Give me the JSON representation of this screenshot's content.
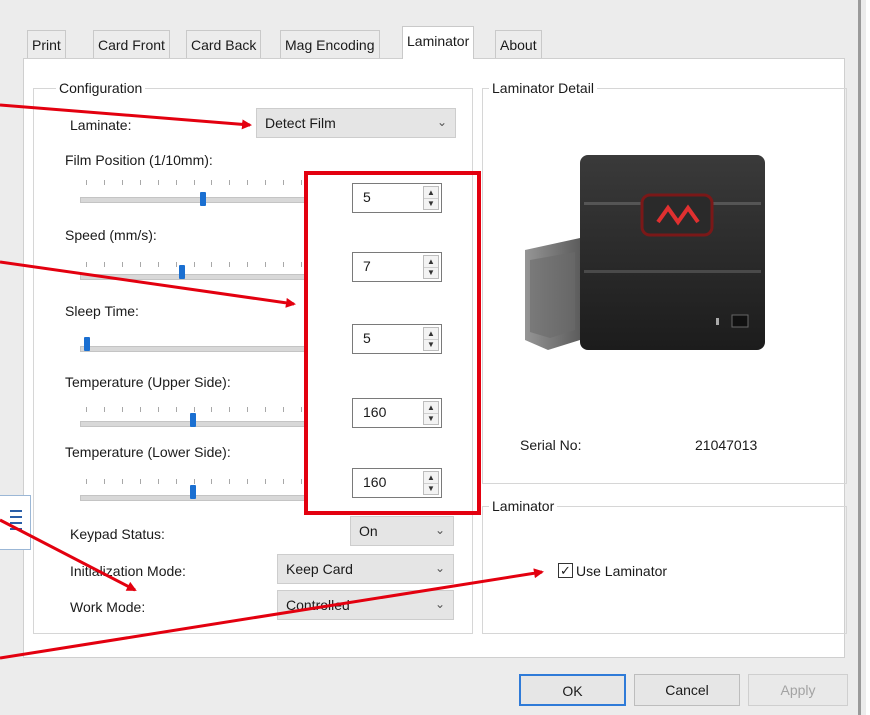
{
  "tabs": [
    {
      "label": "Print"
    },
    {
      "label": "Card Front"
    },
    {
      "label": "Card Back"
    },
    {
      "label": "Mag Encoding"
    },
    {
      "label": "Laminator",
      "active": true
    },
    {
      "label": "About"
    }
  ],
  "configuration": {
    "title": "Configuration",
    "laminate": {
      "label": "Laminate:",
      "value": "Detect Film"
    },
    "film_position": {
      "label": "Film Position (1/10mm):",
      "value": "5",
      "slider_level": 0.55
    },
    "speed": {
      "label": "Speed (mm/s):",
      "value": "7",
      "slider_level": 0.45
    },
    "sleep_time": {
      "label": "Sleep Time:",
      "value": "5",
      "slider_level": 0.02
    },
    "temp_upper": {
      "label": "Temperature (Upper Side):",
      "value": "160",
      "slider_level": 0.5
    },
    "temp_lower": {
      "label": "Temperature (Lower Side):",
      "value": "160",
      "slider_level": 0.5
    },
    "keypad_status": {
      "label": "Keypad Status:",
      "value": "On"
    },
    "initialization_mode": {
      "label": "Initialization Mode:",
      "value": "Keep Card"
    },
    "work_mode": {
      "label": "Work Mode:",
      "value": "Controlled"
    }
  },
  "laminator_detail": {
    "title": "Laminator Detail",
    "serial_label": "Serial No:",
    "serial_value": "21047013"
  },
  "laminator_group": {
    "title": "Laminator",
    "use_laminator_label": "Use Laminator",
    "use_laminator_checked": true
  },
  "buttons": {
    "ok": "OK",
    "cancel": "Cancel",
    "apply": "Apply"
  },
  "colors": {
    "annotation_red": "#e3000f",
    "slider_thumb": "#1a6fd1",
    "default_button_border": "#2f7bd8"
  }
}
